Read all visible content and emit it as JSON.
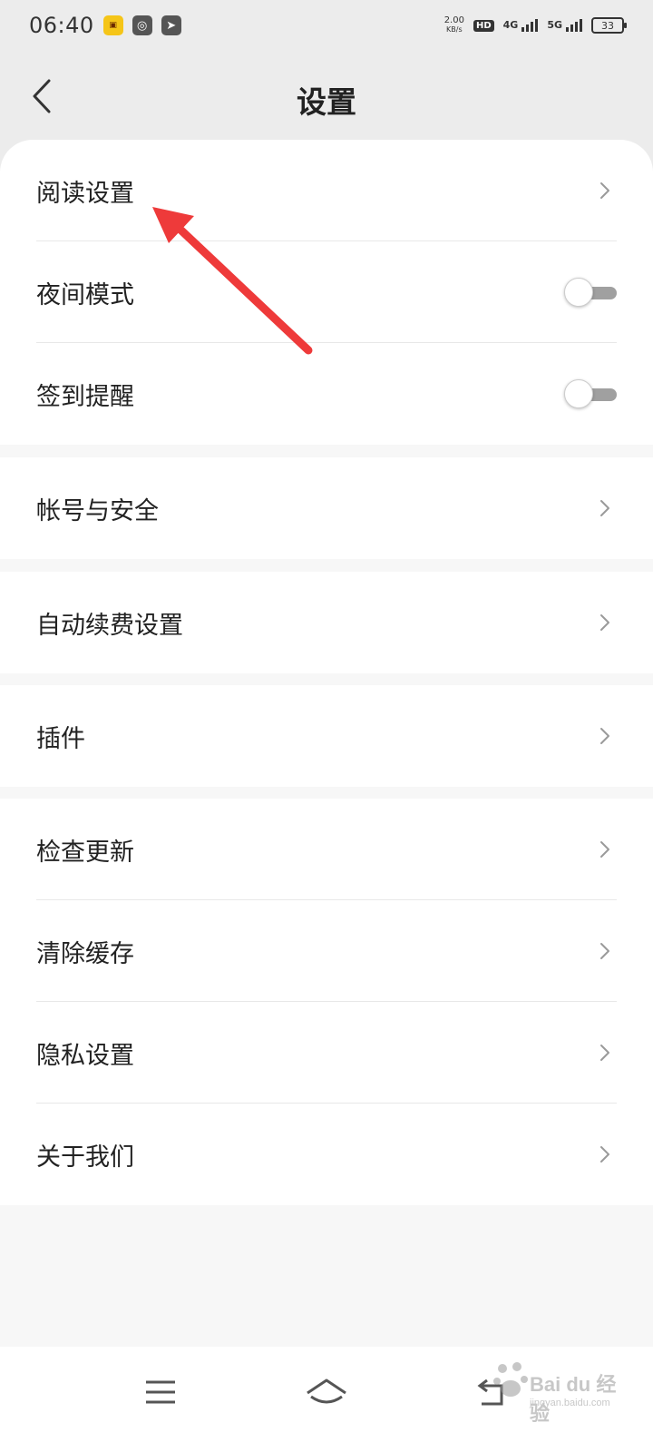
{
  "status_bar": {
    "time": "06:40",
    "net_speed": "2.00",
    "net_unit": "KB/s",
    "hd": "HD",
    "sim1": "4G",
    "sim2": "5G",
    "battery": "33",
    "icons": [
      "app-notification-icon",
      "chat-icon",
      "send-icon"
    ]
  },
  "header": {
    "title": "设置",
    "back_icon": "back-arrow-icon"
  },
  "groups": [
    [
      {
        "label": "阅读设置",
        "control": "chevron"
      },
      {
        "label": "夜间模式",
        "control": "toggle",
        "on": false
      },
      {
        "label": "签到提醒",
        "control": "toggle",
        "on": false
      }
    ],
    [
      {
        "label": "帐号与安全",
        "control": "chevron"
      }
    ],
    [
      {
        "label": "自动续费设置",
        "control": "chevron"
      }
    ],
    [
      {
        "label": "插件",
        "control": "chevron"
      }
    ],
    [
      {
        "label": "检查更新",
        "control": "chevron"
      },
      {
        "label": "清除缓存",
        "control": "chevron"
      },
      {
        "label": "隐私设置",
        "control": "chevron"
      },
      {
        "label": "关于我们",
        "control": "chevron"
      }
    ]
  ],
  "nav": {
    "buttons": [
      "menu-icon",
      "home-icon",
      "back-nav-icon"
    ]
  },
  "watermark": {
    "text": "Bai du 经验",
    "sub": "jingyan.baidu.com"
  },
  "colors": {
    "header_bg": "#ececec",
    "page_bg": "#f7f7f7",
    "card_bg": "#ffffff",
    "annotation_arrow": "#ee3a3a",
    "toggle_off_track": "#a0a0a0"
  }
}
